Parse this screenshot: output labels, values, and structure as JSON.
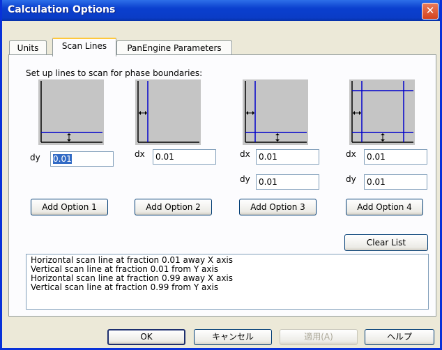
{
  "window": {
    "title": "Calculation Options",
    "close_glyph": "✕"
  },
  "tabs": [
    {
      "label": "Units"
    },
    {
      "label": "Scan Lines"
    },
    {
      "label": "PanEngine Parameters"
    }
  ],
  "heading": "Set up lines to scan for phase boundaries:",
  "options": [
    {
      "fields": [
        {
          "label": "dy",
          "value": "0.01",
          "selected": true
        }
      ],
      "button": "Add Option 1"
    },
    {
      "fields": [
        {
          "label": "dx",
          "value": "0.01"
        }
      ],
      "button": "Add Option 2"
    },
    {
      "fields": [
        {
          "label": "dx",
          "value": "0.01"
        },
        {
          "label": "dy",
          "value": "0.01"
        }
      ],
      "button": "Add Option 3"
    },
    {
      "fields": [
        {
          "label": "dx",
          "value": "0.01"
        },
        {
          "label": "dy",
          "value": "0.01"
        }
      ],
      "button": "Add Option 4"
    }
  ],
  "clear_button": "Clear List",
  "list_items": [
    "Horizontal scan line at fraction 0.01 away X axis",
    "Vertical scan line at fraction 0.01 from Y axis",
    "Horizontal scan line at fraction 0.99 away X axis",
    "Vertical scan line at fraction 0.99 from Y axis"
  ],
  "footer": {
    "ok": "OK",
    "cancel": "キャンセル",
    "apply": "適用(A)",
    "help": "ヘルプ"
  },
  "colors": {
    "scan_line": "#0000cc",
    "diagram_bg": "#c5c5c5"
  }
}
